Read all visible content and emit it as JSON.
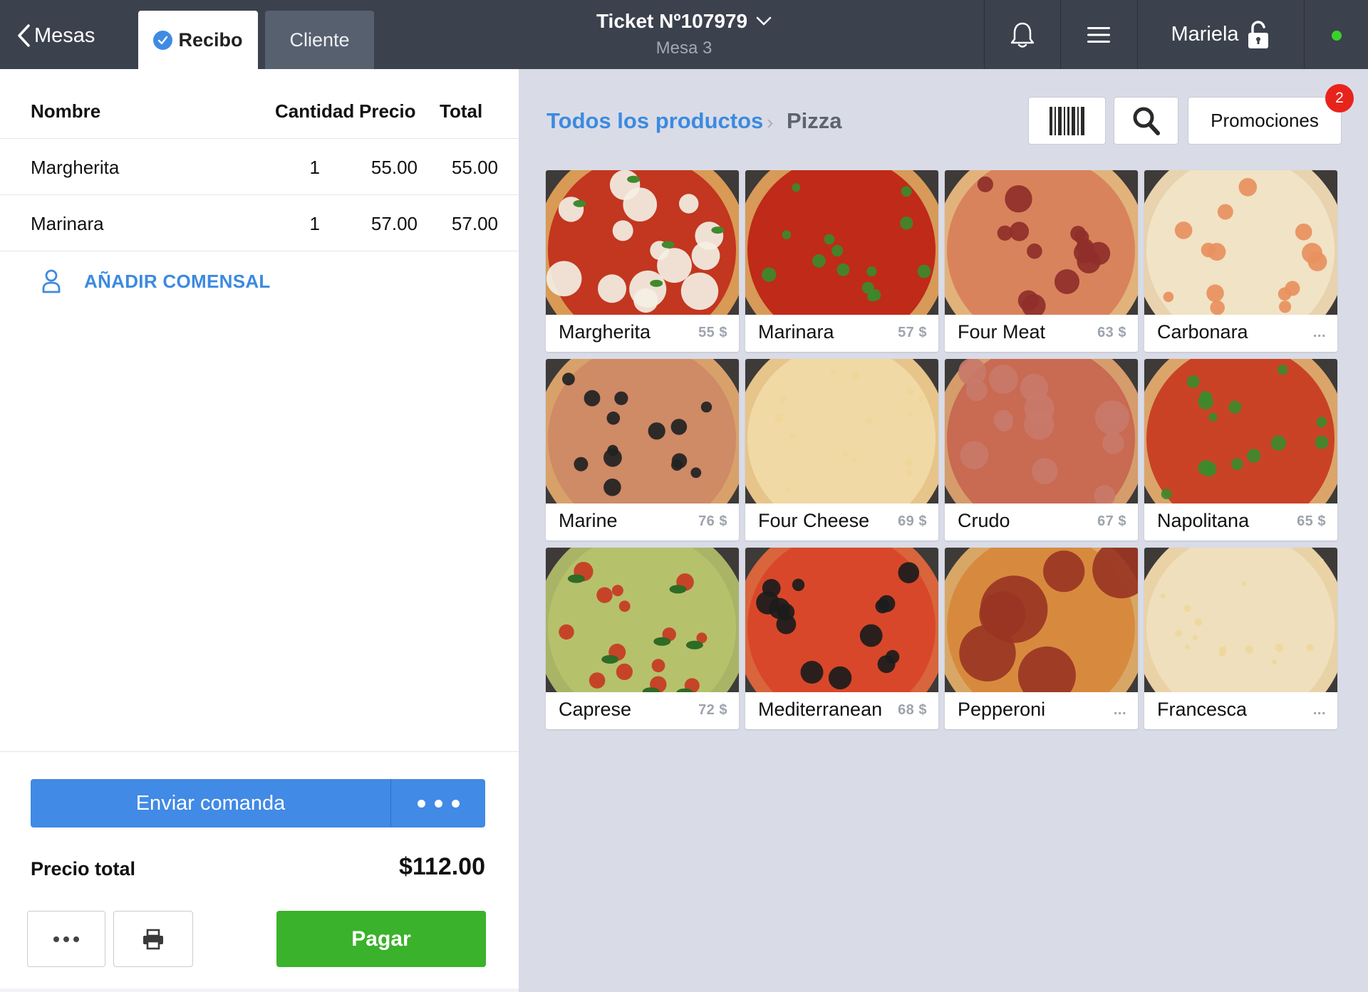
{
  "header": {
    "back_label": "Mesas",
    "tabs": [
      {
        "label": "Recibo",
        "active": true
      },
      {
        "label": "Cliente",
        "active": false
      }
    ],
    "ticket_title": "Ticket Nº107979",
    "ticket_sub": "Mesa 3",
    "user_name": "Mariela",
    "status_color": "#3bd12a"
  },
  "receipt": {
    "columns": [
      "Nombre",
      "Cantidad",
      "Precio",
      "Total"
    ],
    "rows": [
      {
        "name": "Margherita",
        "qty": "1",
        "price": "55.00",
        "total": "55.00"
      },
      {
        "name": "Marinara",
        "qty": "1",
        "price": "57.00",
        "total": "57.00"
      }
    ],
    "add_guest_label": "AÑADIR COMENSAL",
    "send_label": "Enviar comanda",
    "total_label": "Precio total",
    "total_value": "$112.00",
    "pay_label": "Pagar"
  },
  "catalog": {
    "breadcrumb_root": "Todos los productos",
    "breadcrumb_sep": "›",
    "breadcrumb_current": "Pizza",
    "promo_label": "Promociones",
    "promo_badge": "2",
    "products": [
      {
        "name": "Margherita",
        "price": "55 $",
        "crust": "#d99a55",
        "sauce": "#c3361f",
        "toppings": "cheese"
      },
      {
        "name": "Marinara",
        "price": "57 $",
        "crust": "#d79a58",
        "sauce": "#c02a18",
        "toppings": "basil"
      },
      {
        "name": "Four Meat",
        "price": "63 $",
        "crust": "#e2b27b",
        "sauce": "#d9835c",
        "toppings": "meat"
      },
      {
        "name": "Carbonara",
        "price": "...",
        "crust": "#e8d3ae",
        "sauce": "#f1e3c6",
        "toppings": "shrimp"
      },
      {
        "name": "Marine",
        "price": "76 $",
        "crust": "#d9a16a",
        "sauce": "#cf8a66",
        "toppings": "seafood"
      },
      {
        "name": "Four Cheese",
        "price": "69 $",
        "crust": "#e7c48a",
        "sauce": "#f0d9a4",
        "toppings": "plain"
      },
      {
        "name": "Crudo",
        "price": "67 $",
        "crust": "#d59c6c",
        "sauce": "#c96a52",
        "toppings": "ham"
      },
      {
        "name": "Napolitana",
        "price": "65 $",
        "crust": "#dba56a",
        "sauce": "#c94226",
        "toppings": "basil"
      },
      {
        "name": "Caprese",
        "price": "72 $",
        "crust": "#a9b467",
        "sauce": "#b6c16c",
        "toppings": "tomato"
      },
      {
        "name": "Mediterranean",
        "price": "68 $",
        "crust": "#d8653b",
        "sauce": "#d9472a",
        "toppings": "olive"
      },
      {
        "name": "Pepperoni",
        "price": "...",
        "crust": "#d8a766",
        "sauce": "#d78a3e",
        "toppings": "pepperoni"
      },
      {
        "name": "Francesca",
        "price": "...",
        "crust": "#ead2a7",
        "sauce": "#f0dfbd",
        "toppings": "plain"
      }
    ]
  }
}
